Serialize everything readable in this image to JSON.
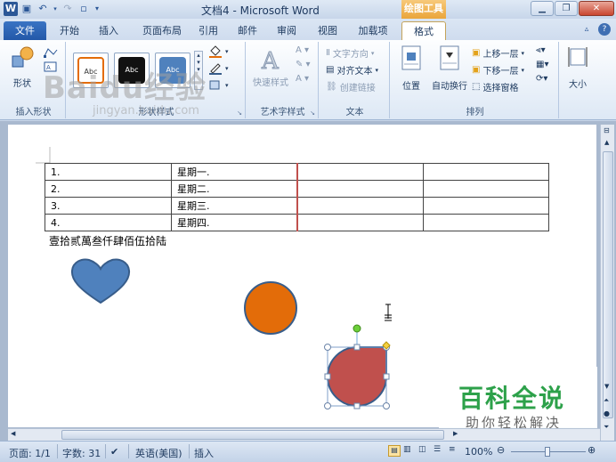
{
  "app": {
    "title": "文档4 - Microsoft Word",
    "context_header": "绘图工具"
  },
  "tabs": [
    "文件",
    "开始",
    "插入",
    "页面布局",
    "引用",
    "邮件",
    "审阅",
    "视图",
    "加载项",
    "格式"
  ],
  "ribbon": {
    "insert_shapes": {
      "shape_label": "形状",
      "group": "插入形状"
    },
    "shape_styles": {
      "thumb1": "Abc",
      "thumb2": "Abc",
      "thumb3": "Abc",
      "group": "形状样式"
    },
    "wordart": {
      "quick_styles": "快速样式",
      "group": "艺术字样式"
    },
    "text": {
      "direction": "文字方向",
      "align": "对齐文本",
      "link": "创建链接",
      "group": "文本"
    },
    "arrange": {
      "position": "位置",
      "wrap": "自动换行",
      "forward": "上移一层",
      "backward": "下移一层",
      "selection_pane": "选择窗格",
      "group": "排列"
    },
    "size": {
      "label": "大小"
    }
  },
  "document": {
    "table": [
      [
        "1.",
        "星期一.",
        "",
        ""
      ],
      [
        "2.",
        "星期二.",
        "",
        ""
      ],
      [
        "3.",
        "星期三.",
        "",
        ""
      ],
      [
        "4.",
        "星期四.",
        "",
        ""
      ]
    ],
    "paragraph": "壹拾贰萬叁仟肆佰伍拾陆"
  },
  "shapes": {
    "heart_color": "#4f81bd",
    "circle_color": "#e36c09",
    "teardrop_color": "#c0504d",
    "outline_color": "#385d8a"
  },
  "watermarks": {
    "logo": "Baidu经验",
    "url": "jingyan.baidu.com",
    "brand_main": "百科全说",
    "brand_sub": "助你轻松解决"
  },
  "status": {
    "page": "页面: 1/1",
    "words": "字数: 31",
    "language": "英语(美国)",
    "mode": "插入",
    "zoom": "100%"
  }
}
